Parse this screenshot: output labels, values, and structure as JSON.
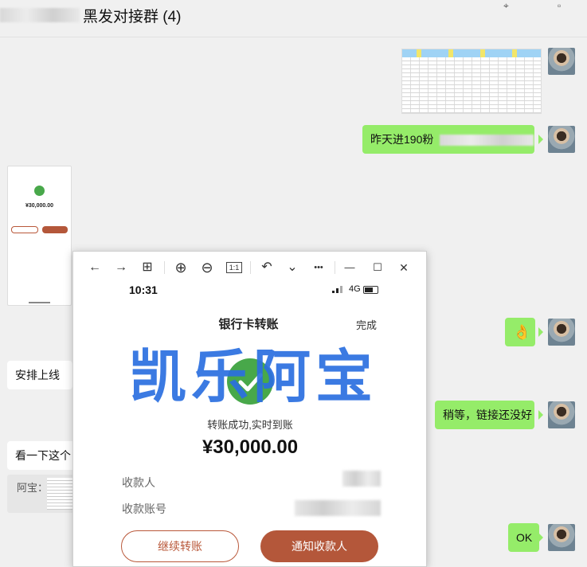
{
  "header": {
    "title": "黑发对接群 (4)"
  },
  "messages": {
    "m1_text": "昨天进190粉",
    "m2_emoji": "👌",
    "m3_text": "安排上线",
    "m4_text": "稍等，链接还没好",
    "m5_text": "看一下这个",
    "m5_quote_label": "阿宝：",
    "m6_text": "OK"
  },
  "thumbnail": {
    "amount": "¥30,000.00"
  },
  "viewer": {
    "toolbar": {
      "back": "←",
      "forward": "→",
      "grid": "⊞",
      "zoom_in": "⊕",
      "zoom_out": "⊖",
      "actual_size": "1:1",
      "rotate": "↶",
      "more_chevron": "⌄",
      "more": "•••",
      "minimize": "—",
      "maximize": "☐",
      "close": "✕"
    },
    "phone": {
      "time": "10:31",
      "network": "4G",
      "title": "银行卡转账",
      "done": "完成",
      "watermark": "凯乐阿宝",
      "success_text": "转账成功,实时到账",
      "amount": "¥30,000.00",
      "payee_label": "收款人",
      "account_label": "收款账号",
      "continue_button": "继续转账",
      "notify_button": "通知收款人"
    }
  },
  "colors": {
    "bubble_green": "#95ec69",
    "button_brown": "#b4573a",
    "watermark_blue": "#2b6fe0"
  }
}
